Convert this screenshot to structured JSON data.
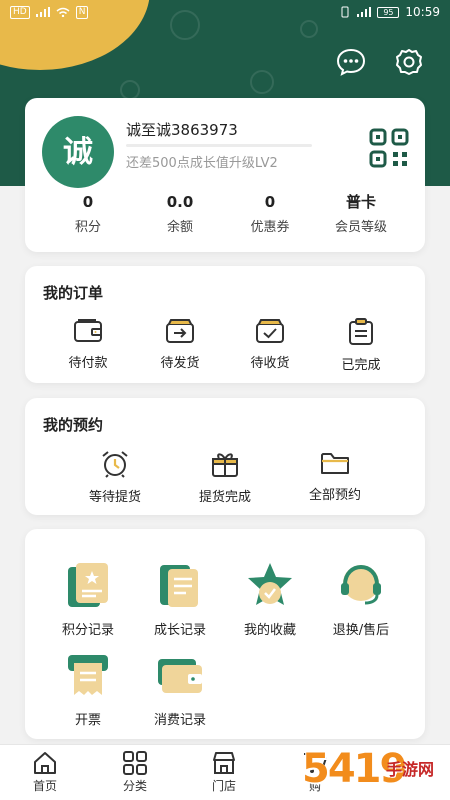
{
  "colors": {
    "header_green": "#1e5a47",
    "accent_gold": "#e8b94a",
    "brand_green": "#2e8a6a",
    "watermark_orange": "#f28c1c"
  },
  "status_bar": {
    "network": "HD",
    "carrier_chip": "N",
    "battery": "95",
    "time": "10:59"
  },
  "header": {
    "message_icon": "chat-bubble-icon",
    "settings_icon": "gear-icon"
  },
  "profile": {
    "avatar_text": "诚",
    "username": "诚至诚3863973",
    "level_progress": 0.0,
    "level_hint": "还差500点成长值升级LV2",
    "qr_icon": "qr-code-icon",
    "stats": [
      {
        "value": "0",
        "label": "积分"
      },
      {
        "value": "0.0",
        "label": "余额"
      },
      {
        "value": "0",
        "label": "优惠券"
      },
      {
        "value": "普卡",
        "label": "会员等级"
      }
    ]
  },
  "orders": {
    "title": "我的订单",
    "items": [
      {
        "label": "待付款",
        "icon": "wallet-icon"
      },
      {
        "label": "待发货",
        "icon": "box-arrow-icon"
      },
      {
        "label": "待收货",
        "icon": "box-check-icon"
      },
      {
        "label": "已完成",
        "icon": "clipboard-icon"
      }
    ]
  },
  "reservations": {
    "title": "我的预约",
    "items": [
      {
        "label": "等待提货",
        "icon": "alarm-clock-icon"
      },
      {
        "label": "提货完成",
        "icon": "gift-icon"
      },
      {
        "label": "全部预约",
        "icon": "folder-icon"
      }
    ]
  },
  "services": {
    "items": [
      {
        "label": "积分记录",
        "icon": "points-card-icon"
      },
      {
        "label": "成长记录",
        "icon": "document-icon"
      },
      {
        "label": "我的收藏",
        "icon": "star-icon"
      },
      {
        "label": "退换/售后",
        "icon": "headset-icon"
      },
      {
        "label": "开票",
        "icon": "invoice-icon"
      },
      {
        "label": "消费记录",
        "icon": "wallet-card-icon"
      }
    ]
  },
  "tabbar": {
    "items": [
      {
        "label": "首页",
        "icon": "home-icon"
      },
      {
        "label": "分类",
        "icon": "grid-icon"
      },
      {
        "label": "门店",
        "icon": "store-icon"
      },
      {
        "label": "购",
        "icon": "cart-icon"
      }
    ]
  },
  "watermark": {
    "number": "5419",
    "text": "手游网"
  }
}
